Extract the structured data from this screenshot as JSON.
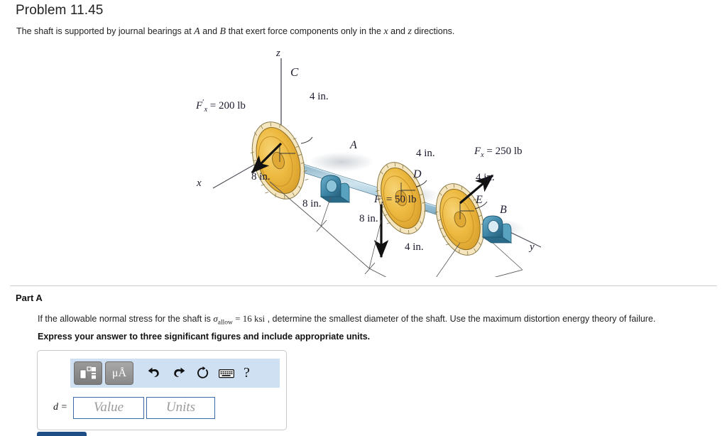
{
  "header": {
    "problem_title": "Problem 11.45",
    "intro_pre": "The shaft is supported by journal bearings at ",
    "intro_a": "A",
    "intro_mid": " and ",
    "intro_b": "B",
    "intro_post": " that exert force components only in the ",
    "intro_x": "x",
    "intro_and": " and ",
    "intro_z": "z",
    "intro_end": " directions."
  },
  "figure": {
    "axis_z": "z",
    "axis_x": "x",
    "axis_y": "y",
    "point_c": "C",
    "point_a": "A",
    "point_d": "D",
    "point_e": "E",
    "point_b": "B",
    "force_c": "F'x = 200 lb",
    "force_c_sym": "F",
    "force_c_prime": "′",
    "force_c_sub": "x",
    "force_c_val": "= 200 lb",
    "force_d_sym": "F",
    "force_d_sub": "z",
    "force_d_val": "= 50 lb",
    "force_e_sym": "F",
    "force_e_sub": "x",
    "force_e_val": "= 250 lb",
    "radius_c": "4 in.",
    "radius_d": "4 in.",
    "radius_e": "4 in.",
    "dim_1": "8 in.",
    "dim_2": "8 in.",
    "dim_3": "8 in.",
    "dim_4": "4 in.",
    "colors": {
      "gear_body": "#edb93f",
      "gear_teeth": "#f6e6bf",
      "gear_outline": "#6b5a2a",
      "shaft": "#93bdd4",
      "shaft_dark": "#5f93ae",
      "bearing": "#3f87a8",
      "bearing_dark": "#2a6a88",
      "arrow": "#111111",
      "label": "#1b1b2e",
      "shadow": "#d8dde2"
    }
  },
  "part": {
    "title": "Part A",
    "question_pre": "If the allowable normal stress for the shaft is ",
    "question_sigma": "σ",
    "question_sub": "allow",
    "question_eq": " = 16 ksi",
    "question_post": " , determine the smallest diameter of the shaft. Use the maximum distortion energy theory of failure.",
    "note": "Express your answer to three significant figures and include appropriate units."
  },
  "answer": {
    "toolbar": {
      "template_button": "template-icon",
      "units_button": "μÅ",
      "undo": "undo-icon",
      "redo": "redo-icon",
      "reset": "reset-icon",
      "keyboard": "keyboard-icon",
      "help": "?"
    },
    "eq_label": "d =",
    "value_placeholder": "Value",
    "units_placeholder": "Units"
  }
}
